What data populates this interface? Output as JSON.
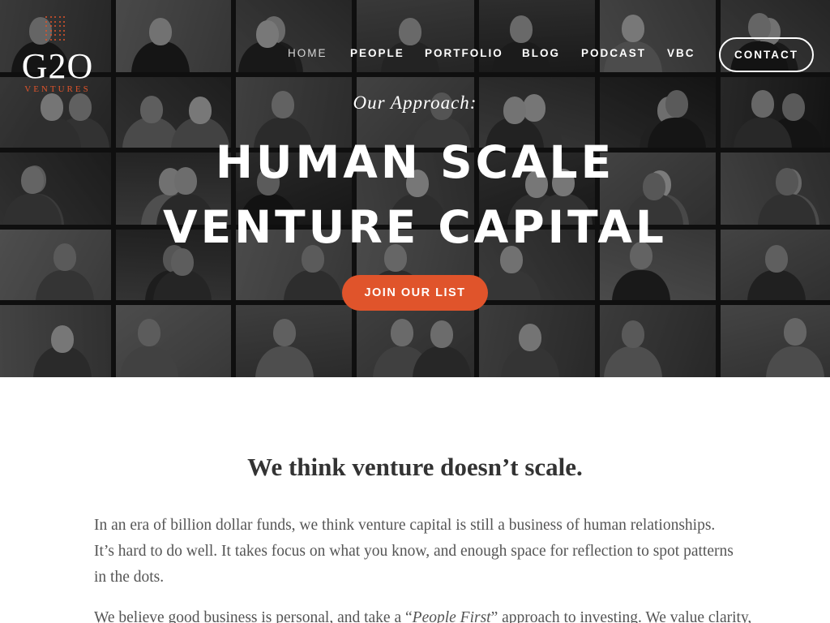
{
  "logo": {
    "mark": "G2O",
    "sub": "VENTURES"
  },
  "nav": {
    "items": [
      {
        "label": "HOME",
        "active": true
      },
      {
        "label": "PEOPLE"
      },
      {
        "label": "PORTFOLIO"
      },
      {
        "label": "BLOG"
      },
      {
        "label": "PODCAST"
      },
      {
        "label": "VBC"
      }
    ],
    "contact_label": "CONTACT"
  },
  "hero": {
    "eyebrow": "Our Approach:",
    "headline_line1": "HUMAN SCALE",
    "headline_line2": "VENTURE CAPITAL",
    "cta_label": "JOIN OUR LIST"
  },
  "content": {
    "title": "We think venture doesn’t scale.",
    "paragraph1": "In an era of billion dollar funds, we think venture capital is still a business of human relationships. It’s hard to do well. It takes focus on what you know, and enough space for reflection to spot patterns in the dots.",
    "paragraph2_before": "We believe good business is personal, and take a “",
    "paragraph2_em": "People First",
    "paragraph2_after": "” approach to investing. We value clarity,"
  },
  "colors": {
    "accent": "#e0542b",
    "text_dark": "#333333",
    "text_body": "#555555",
    "hero_overlay": "rgba(0,0,0,0.44)"
  }
}
